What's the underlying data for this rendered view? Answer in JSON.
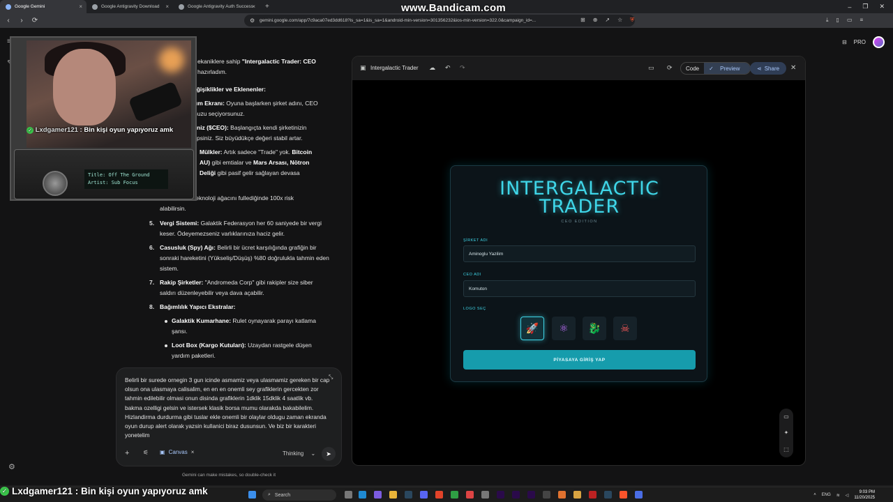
{
  "browser": {
    "tabs": [
      {
        "title": "Google Gemini",
        "active": true
      },
      {
        "title": "Google Antigravity Download",
        "active": false
      },
      {
        "title": "Google Antigravity Auth Success",
        "active": false
      }
    ],
    "new_tab": "+",
    "url": "gemini.google.com/app/7c9aca07ed3dd618?is_sa=1&is_sa=1&android-min-version=301356232&ios-min-version=322.0&campaign_id=...",
    "watermark": "www.Bandicam.com"
  },
  "header": {
    "pro_label": "PRO"
  },
  "chat": {
    "intro": {
      "line1_pre": "ekaniklere sahip ",
      "line1_bold": "\"Intergalactic Trader: CEO",
      "line2": "hazırladım."
    },
    "changes_heading": "eğişiklikler ve Eklenenler:",
    "partials": [
      {
        "bold": "um Ekranı:",
        "text": " Oyuna başlarken şirket adını, CEO"
      },
      {
        "bold": "",
        "text": "nuzu seçiyorsunuz."
      },
      {
        "bold": "niz ($CEO):",
        "text": " Başlangıçta kendi şirketinizin"
      },
      {
        "bold": "",
        "text": "psiniz. Siz büyüdükçe değeri stabil artar."
      },
      {
        "bold": "Mülkler:",
        "text": " Artık sadece \"Trade\" yok. "
      },
      {
        "bold": "AU)",
        "text": " gibi emtialar ve "
      },
      {
        "bold": "Deliği",
        "text": " gibi pasif gelir sağlayan devasa"
      },
      {
        "bold": "",
        "text": "Teknoloji ağacını fullediğinde 100x risk"
      }
    ],
    "partial_extra": {
      "bitcoin": "Bitcoin",
      "mars": "Mars Arsası, Nötron",
      "alabilirsin": "alabilirsin."
    },
    "items": [
      {
        "num": "5.",
        "bold": "Vergi Sistemi:",
        "text": " Galaktik Federasyon her 60 saniyede bir vergi keser. Ödeyemezseniz varlıklarınıza haciz gelir."
      },
      {
        "num": "6.",
        "bold": "Casusluk (Spy) Ağı:",
        "text": " Belirli bir ücret karşılığında grafiğin bir sonraki hareketini (Yükseliş/Düşüş) %80 doğrulukla tahmin eden sistem."
      },
      {
        "num": "7.",
        "bold": "Rakip Şirketler:",
        "text": " \"Andromeda Corp\" gibi rakipler size siber saldırı düzenleyebilir veya dava açabilir."
      },
      {
        "num": "8.",
        "bold": "Bağımlılık Yapıcı Ekstralar:",
        "text": ""
      }
    ],
    "subitems": [
      {
        "bold": "Galaktik Kumarhane:",
        "text": " Rulet oynayarak parayı katlama şansı."
      },
      {
        "bold": "Loot Box (Kargo Kutuları):",
        "text": " Uzaydan rastgele düşen yardım paketleri."
      }
    ]
  },
  "input": {
    "text": "Belirli bir surede ornegin 3 gun icinde asmamiz veya ulasmamiz gereken bir cap olsun ona ulasmaya calisalim, en en en onemli sey grafiklerin gercekten zor tahmin edilebilir olmasi onun disinda grafiklerin 1dklik 15dklik 4 saatlik vb. bakma ozelligi gelsin ve istersek klasik borsa mumu olarakda bakabilelim. Hizlandirma durdurma gibi tuslar ekle onemli bir olaylar oldugu zaman ekranda oyun durup alert olarak yazsin kullanici biraz dusunsun. Ve biz bir karakteri yonetelim",
    "canvas_chip": "Canvas",
    "mode": "Thinking",
    "disclaimer": "Gemini can make mistakes, so double-check it"
  },
  "canvas": {
    "title": "Intergalactic Trader",
    "code_label": "Code",
    "preview_label": "Preview",
    "share_label": "Share"
  },
  "game": {
    "title_line1": "INTERGALACTIC",
    "title_line2": "TRADER",
    "subtitle": "CEO EDITION",
    "company_label": "ŞİRKET ADI",
    "company_value": "Aminoglu Yazilim",
    "ceo_label": "CEO ADI",
    "ceo_value": "Komuton",
    "logo_label": "LOGO SEÇ",
    "logos": [
      {
        "icon": "rocket-icon",
        "glyph": "🚀",
        "selected": true
      },
      {
        "icon": "atom-icon",
        "glyph": "⚛",
        "selected": false
      },
      {
        "icon": "dragon-icon",
        "glyph": "🐉",
        "selected": false
      },
      {
        "icon": "skull-crossbones-icon",
        "glyph": "☠",
        "selected": false
      }
    ],
    "start_button": "PİYASAYA GİRİŞ YAP",
    "colors": {
      "accent": "#3fd6e8",
      "button": "#169cac"
    }
  },
  "overlay": {
    "cam_user": "Lxdgamer121",
    "cam_message": " : Bin kişi oyun yapıyoruz amk",
    "radio_title": "Title: Off The Ground",
    "radio_artist": "Artist: Sub Focus",
    "bottom_user": "Lxdgamer121",
    "bottom_message": " : Bin kişi oyun yapıyoruz amk"
  },
  "taskbar": {
    "search": "Search",
    "lang": "ENG",
    "time": "9:03 PM",
    "date": "11/20/2025"
  }
}
